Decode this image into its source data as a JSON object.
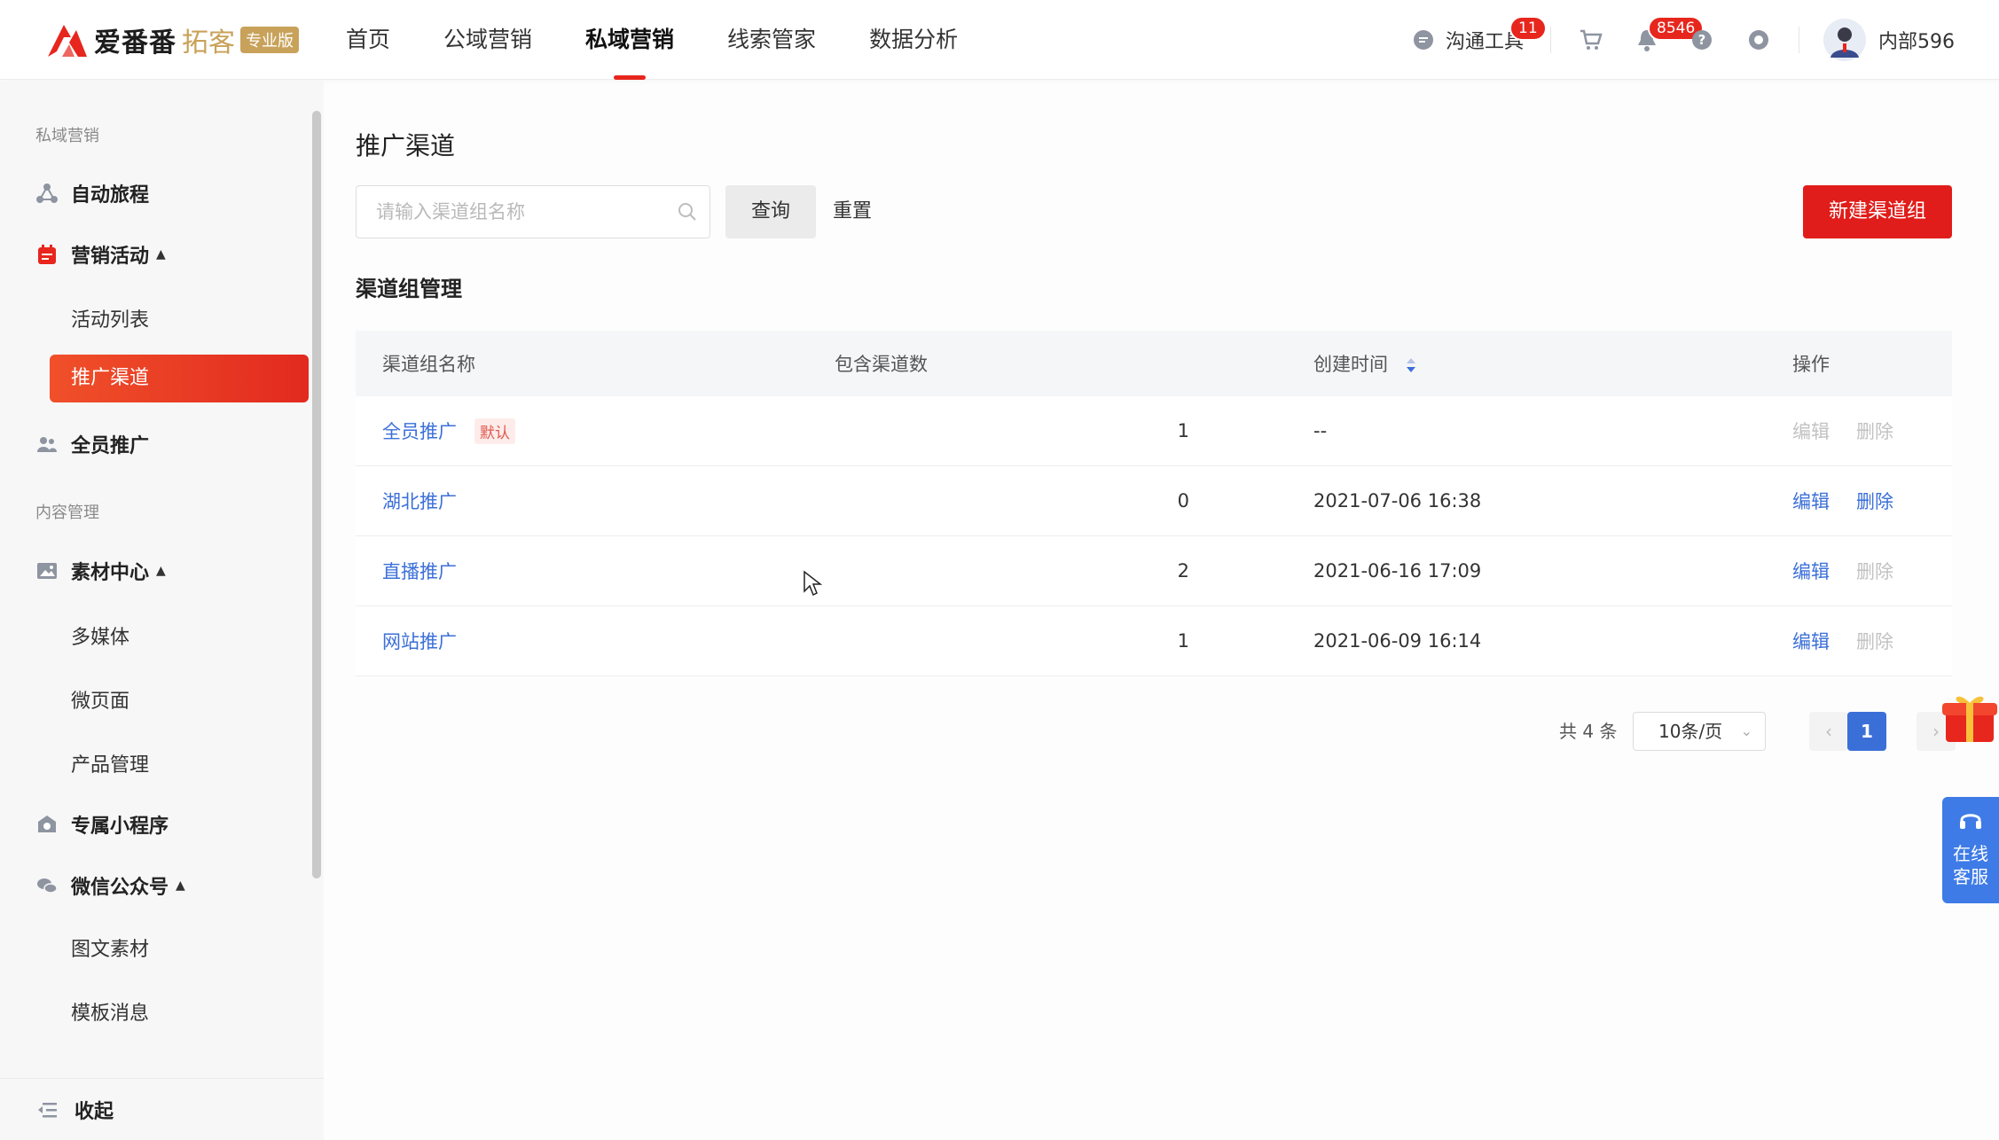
{
  "header": {
    "logo_text": "爱番番",
    "logo_sub": "拓客",
    "logo_badge": "专业版",
    "nav": [
      {
        "label": "首页",
        "active": false
      },
      {
        "label": "公域营销",
        "active": false
      },
      {
        "label": "私域营销",
        "active": true
      },
      {
        "label": "线索管家",
        "active": false
      },
      {
        "label": "数据分析",
        "active": false
      }
    ],
    "comm_tool_label": "沟通工具",
    "comm_badge": "11",
    "notif_badge": "8546",
    "user_name": "内部596"
  },
  "sidebar": {
    "group1": "私域营销",
    "auto_journey": "自动旅程",
    "marketing": "营销活动",
    "activity_list": "活动列表",
    "promo_channel": "推广渠道",
    "all_staff": "全员推广",
    "group2": "内容管理",
    "material_center": "素材中心",
    "multimedia": "多媒体",
    "micro_page": "微页面",
    "product_mgmt": "产品管理",
    "mini_program": "专属小程序",
    "wechat_oa": "微信公众号",
    "article_material": "图文素材",
    "template_msg": "模板消息",
    "collapse": "收起"
  },
  "main": {
    "page_title": "推广渠道",
    "search_placeholder": "请输入渠道组名称",
    "query_btn": "查询",
    "reset_btn": "重置",
    "new_btn": "新建渠道组",
    "section_title": "渠道组管理",
    "columns": [
      "渠道组名称",
      "包含渠道数",
      "创建时间",
      "操作"
    ],
    "rows": [
      {
        "name": "全员推广",
        "tag": "默认",
        "count": "1",
        "time": "--",
        "edit": "编辑",
        "del": "删除",
        "edit_enabled": false,
        "del_enabled": false
      },
      {
        "name": "湖北推广",
        "tag": "",
        "count": "0",
        "time": "2021-07-06 16:38",
        "edit": "编辑",
        "del": "删除",
        "edit_enabled": true,
        "del_enabled": true
      },
      {
        "name": "直播推广",
        "tag": "",
        "count": "2",
        "time": "2021-06-16 17:09",
        "edit": "编辑",
        "del": "删除",
        "edit_enabled": true,
        "del_enabled": false
      },
      {
        "name": "网站推广",
        "tag": "",
        "count": "1",
        "time": "2021-06-09 16:14",
        "edit": "编辑",
        "del": "删除",
        "edit_enabled": true,
        "del_enabled": false
      }
    ],
    "pager": {
      "total": "共 4 条",
      "page_size": "10条/页",
      "current": "1"
    }
  },
  "floating": {
    "service_line1": "在线",
    "service_line2": "客服"
  },
  "colors": {
    "brand_red": "#e01d1a",
    "link_blue": "#3b6fd8",
    "gold": "#c8a25a"
  }
}
